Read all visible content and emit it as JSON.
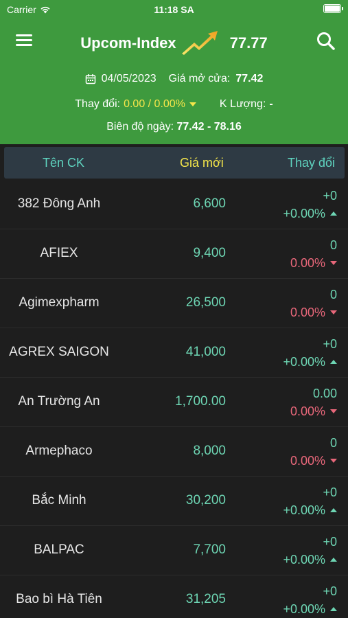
{
  "status_bar": {
    "carrier": "Carrier",
    "time": "11:18 SA"
  },
  "header": {
    "title": "Upcom-Index",
    "index_value": "77.77",
    "date": "04/05/2023",
    "open_label": "Giá mở cửa:",
    "open_value": "77.42",
    "change_label": "Thay đổi:",
    "change_value": "0.00 / 0.00%",
    "volume_label": "K Lượng:",
    "volume_value": "-",
    "range_label": "Biên độ ngày:",
    "range_value": "77.42 - 78.16"
  },
  "table": {
    "columns": {
      "name": "Tên CK",
      "price": "Giá mới",
      "change": "Thay đổi"
    },
    "rows": [
      {
        "name": "382 Đông Anh",
        "price": "6,600",
        "change_abs": "+0",
        "change_pct": "+0.00%",
        "dir": "up",
        "abs_color": "up"
      },
      {
        "name": "AFIEX",
        "price": "9,400",
        "change_abs": "0",
        "change_pct": "0.00%",
        "dir": "down",
        "abs_color": "up"
      },
      {
        "name": "Agimexpharm",
        "price": "26,500",
        "change_abs": "0",
        "change_pct": "0.00%",
        "dir": "down",
        "abs_color": "up"
      },
      {
        "name": "AGREX SAIGON",
        "price": "41,000",
        "change_abs": "+0",
        "change_pct": "+0.00%",
        "dir": "up",
        "abs_color": "up"
      },
      {
        "name": "An Trường An",
        "price": "1,700.00",
        "change_abs": "0.00",
        "change_pct": "0.00%",
        "dir": "down",
        "abs_color": "up"
      },
      {
        "name": "Armephaco",
        "price": "8,000",
        "change_abs": "0",
        "change_pct": "0.00%",
        "dir": "down",
        "abs_color": "up"
      },
      {
        "name": "Bắc Minh",
        "price": "30,200",
        "change_abs": "+0",
        "change_pct": "+0.00%",
        "dir": "up",
        "abs_color": "up"
      },
      {
        "name": "BALPAC",
        "price": "7,700",
        "change_abs": "+0",
        "change_pct": "+0.00%",
        "dir": "up",
        "abs_color": "up"
      },
      {
        "name": "Bao bì Hà Tiên",
        "price": "31,205",
        "change_abs": "+0",
        "change_pct": "+0.00%",
        "dir": "up",
        "abs_color": "up"
      }
    ]
  },
  "colors": {
    "header_bg": "#3e9a3e",
    "body_bg": "#1e1e1e",
    "up": "#6ed6b4",
    "down": "#e8677a",
    "highlight": "#f5e64a"
  },
  "icons": {
    "menu": "hamburger-icon",
    "trend": "trend-up-icon",
    "search": "search-icon",
    "calendar": "calendar-icon"
  }
}
